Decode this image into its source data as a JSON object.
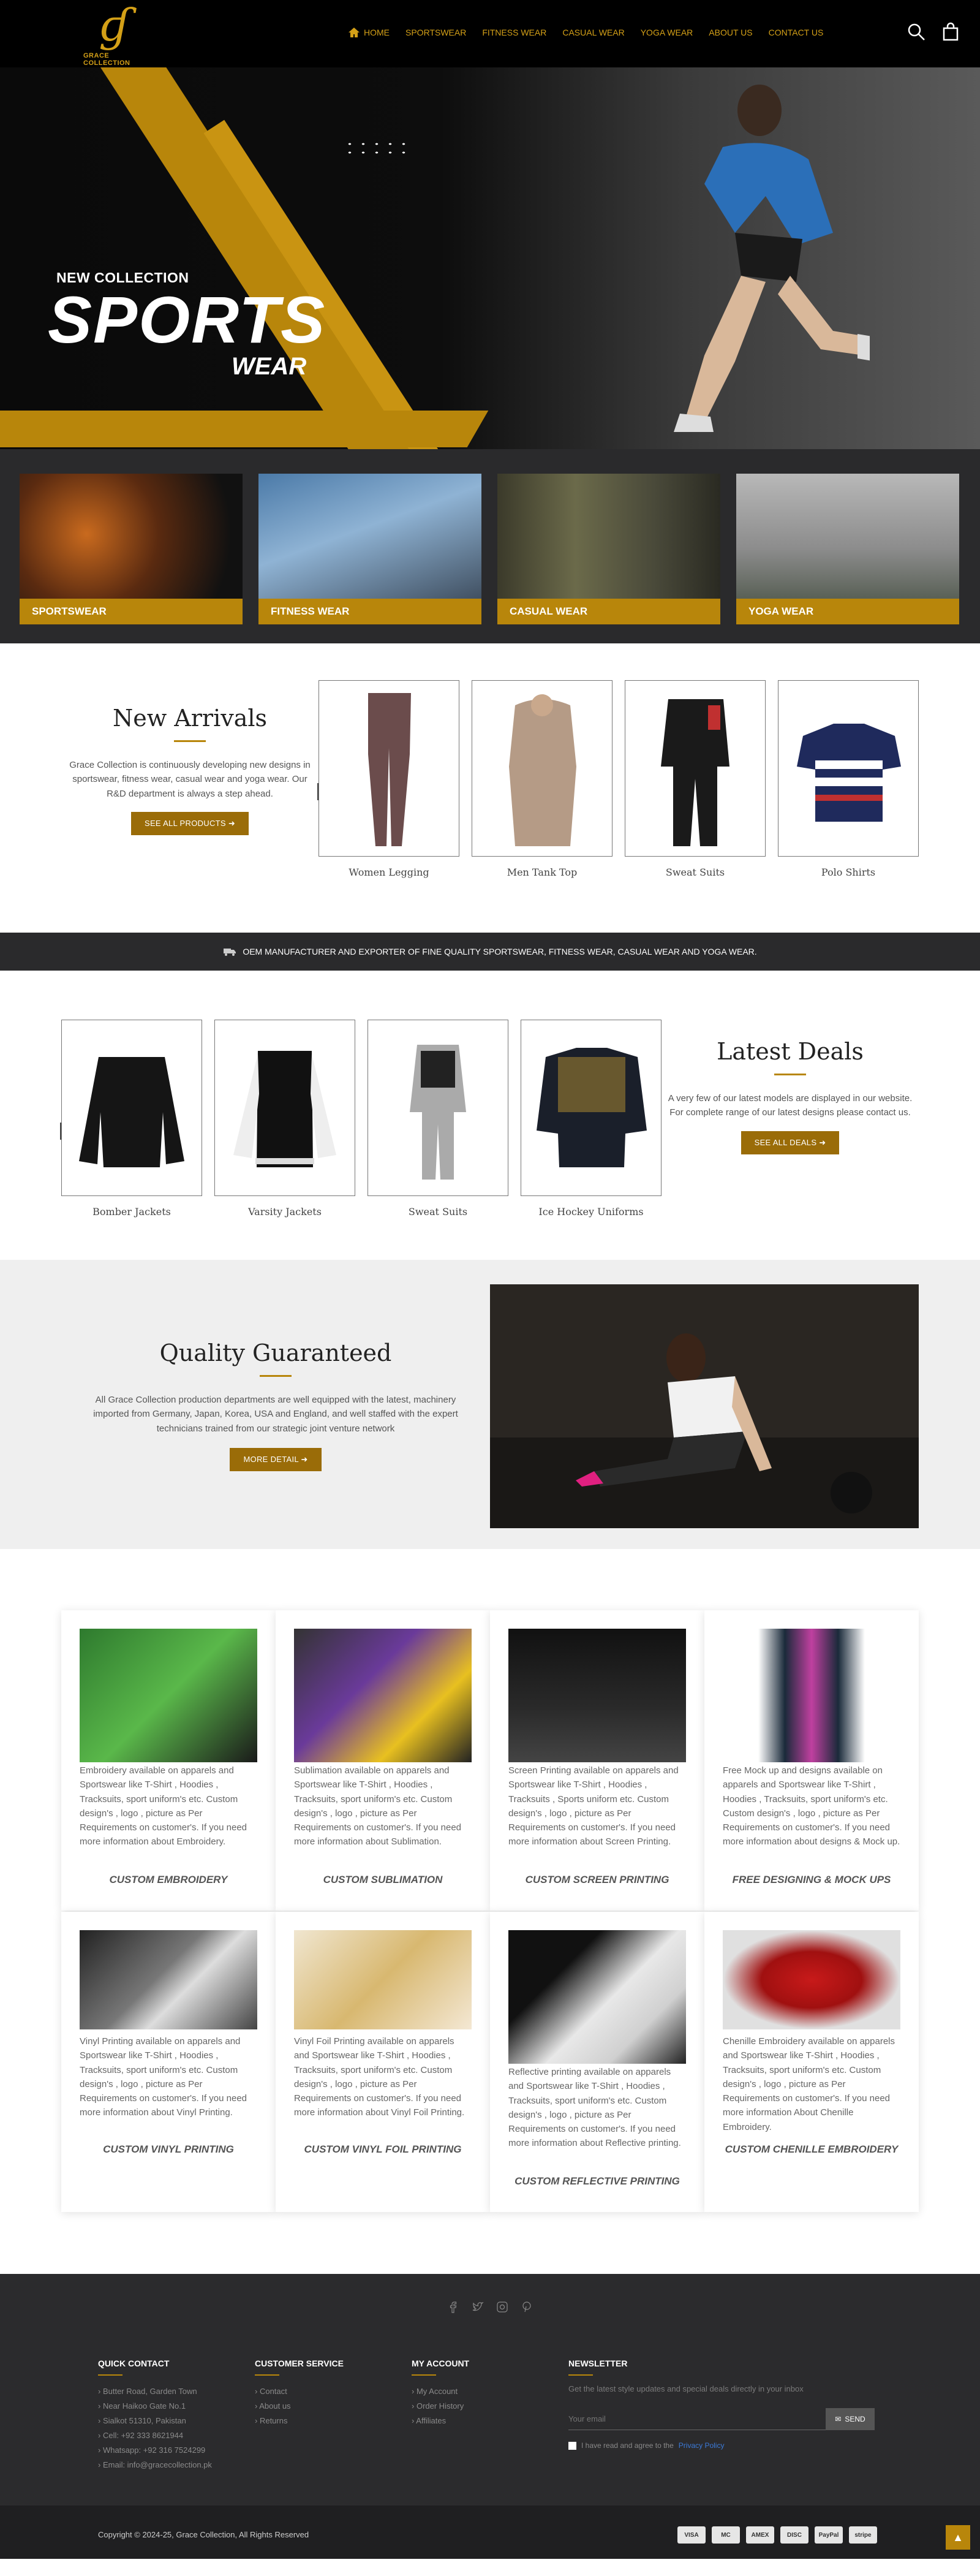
{
  "header": {
    "logo_text": "GRACE COLLECTION",
    "nav": [
      "HOME",
      "SPORTSWEAR",
      "FITNESS WEAR",
      "CASUAL WEAR",
      "YOGA WEAR",
      "ABOUT US",
      "CONTACT US"
    ],
    "icons": [
      "search-icon",
      "bag-icon"
    ]
  },
  "hero": {
    "kicker": "NEW COLLECTION",
    "headline": "SPORTS",
    "sub": "WEAR"
  },
  "categories": [
    "SPORTSWEAR",
    "FITNESS WEAR",
    "CASUAL WEAR",
    "YOGA WEAR"
  ],
  "new_arrivals": {
    "title": "New Arrivals",
    "text": "Grace Collection is continuously developing new designs in sportswear, fitness wear, casual wear and yoga wear. Our R&D department is always a step ahead.",
    "button": "SEE ALL PRODUCTS",
    "products": [
      "Women Legging",
      "Men Tank Top",
      "Sweat Suits",
      "Polo Shirts"
    ]
  },
  "oem_bar": "OEM MANUFACTURER AND EXPORTER OF FINE QUALITY SPORTSWEAR, FITNESS WEAR, CASUAL WEAR AND YOGA WEAR.",
  "latest_deals": {
    "title": "Latest Deals",
    "text": "A very few of our latest models are displayed in our website. For complete range of our latest designs please contact us.",
    "button": "SEE ALL DEALS",
    "products": [
      "Bomber Jackets",
      "Varsity Jackets",
      "Sweat Suits",
      "Ice Hockey Uniforms"
    ]
  },
  "quality": {
    "title": "Quality Guaranteed",
    "text": "All Grace Collection production departments are well equipped with the latest, machinery imported from Germany, Japan, Korea, USA and England, and well staffed with the expert technicians trained from our strategic joint venture network",
    "button": "MORE DETAIL"
  },
  "services": [
    {
      "title": "CUSTOM EMBROIDERY",
      "desc": "Embroidery available on apparels and Sportswear like T-Shirt , Hoodies , Tracksuits, sport uniform's etc. Custom design's , logo , picture as Per Requirements on customer's. If you need more information about Embroidery."
    },
    {
      "title": "CUSTOM SUBLIMATION",
      "desc": "Sublimation available on apparels and Sportswear like T-Shirt , Hoodies , Tracksuits, sport uniform's etc. Custom design's , logo , picture as Per Requirements on customer's. If you need more information about Sublimation."
    },
    {
      "title": "CUSTOM SCREEN PRINTING",
      "desc": "Screen Printing available on apparels and Sportswear like T-Shirt , Hoodies , Tracksuits , Sports uniform etc. Custom design's , logo , picture as Per Requirements on customer's. If you need more information about Screen Printing."
    },
    {
      "title": "FREE DESIGNING & MOCK UPS",
      "desc": "Free Mock up and designs available on apparels and Sportswear like T-Shirt , Hoodies , Tracksuits, sport uniform's etc. Custom design's , logo , picture as Per Requirements on customer's. If you need more information about designs & Mock up."
    },
    {
      "title": "CUSTOM VINYL PRINTING",
      "desc": "Vinyl Printing available on apparels and Sportswear like T-Shirt , Hoodies , Tracksuits, sport uniform's etc. Custom design's , logo , picture as Per Requirements on customer's. If you need more information about Vinyl Printing."
    },
    {
      "title": "CUSTOM VINYL FOIL PRINTING",
      "desc": "Vinyl Foil Printing available on apparels and Sportswear like T-Shirt , Hoodies , Tracksuits, sport uniform's etc. Custom design's , logo , picture as Per Requirements on customer's. If you need more information about Vinyl Foil Printing."
    },
    {
      "title": "CUSTOM REFLECTIVE PRINTING",
      "desc": "Reflective printing available on apparels and Sportswear like T-Shirt , Hoodies , Tracksuits, sport uniform's etc. Custom design's , logo , picture as Per Requirements on customer's. If you need more information about Reflective printing."
    },
    {
      "title": "CUSTOM CHENILLE EMBROIDERY",
      "desc": "Chenille Embroidery available on apparels and Sportswear like T-Shirt , Hoodies , Tracksuits, sport uniform's etc. Custom design's , logo , picture as Per Requirements on customer's. If you need more information About Chenille Embroidery."
    }
  ],
  "footer": {
    "quick_contact": {
      "title": "QUICK CONTACT",
      "items": [
        "Butter Road, Garden Town",
        "Near Haikoo Gate No.1",
        "Sialkot 51310, Pakistan",
        "Cell: +92 333 8621944",
        "Whatsapp: +92 316 7524299",
        "Email: info@gracecollection.pk"
      ]
    },
    "customer_service": {
      "title": "CUSTOMER SERVICE",
      "items": [
        "Contact",
        "About us",
        "Returns"
      ]
    },
    "my_account": {
      "title": "MY ACCOUNT",
      "items": [
        "My Account",
        "Order History",
        "Affiliates"
      ]
    },
    "newsletter": {
      "title": "NEWSLETTER",
      "text": "Get the latest style updates and special deals directly in your inbox",
      "placeholder": "Your email",
      "button": "SEND",
      "agree": "I have read and agree to the",
      "policy": "Privacy Policy"
    },
    "copyright": "Copyright © 2024-25, Grace Collection, All Rights Reserved",
    "payments": [
      "VISA",
      "MC",
      "AMEX",
      "DISC",
      "PayPal",
      "stripe"
    ]
  }
}
